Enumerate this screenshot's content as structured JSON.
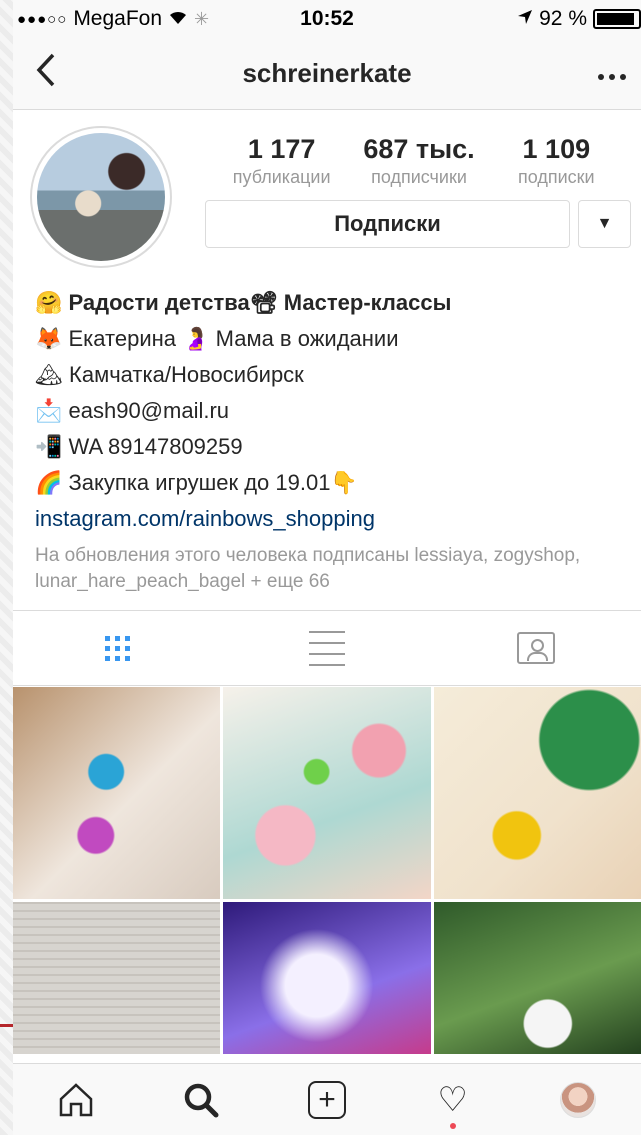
{
  "status_bar": {
    "signal": "●●●○○",
    "carrier": "MegaFon",
    "time": "10:52",
    "battery": "92 %"
  },
  "header": {
    "back_icon": "chevron-left-icon",
    "username": "schreinerkate",
    "more_icon": "ellipsis-icon"
  },
  "profile": {
    "stats": [
      {
        "value": "1 177",
        "label": "публикации"
      },
      {
        "value": "687 тыс.",
        "label": "подписчики"
      },
      {
        "value": "1 109",
        "label": "подписки"
      }
    ],
    "follow_button": "Подписки",
    "dropdown_icon": "▼"
  },
  "bio": {
    "line1": "🤗 Радости детства📽 Мастер-классы",
    "line2": "🦊 Екатерина 🤰 Мама в ожидании",
    "line3": "🏔 Камчатка/Новосибирск",
    "line4": "📩 eash90@mail.ru",
    "line5": "📲 WA 89147809259",
    "line6": "🌈 Закупка игрушек до 19.01👇",
    "link": "instagram.com/rainbows_shopping",
    "followed_by": "На обновления этого человека подписаны lessiaya, zogyshop, lunar_hare_peach_bagel + еще 66"
  },
  "view_tabs": [
    {
      "name": "grid",
      "icon": "grid-icon",
      "active": true,
      "color": "#3897f0"
    },
    {
      "name": "list",
      "icon": "list-icon",
      "active": false
    },
    {
      "name": "tagged",
      "icon": "tagged-icon",
      "active": false
    }
  ],
  "tab_bar": {
    "items": [
      "home-icon",
      "search-icon",
      "add-icon",
      "heart-icon",
      "profile-icon"
    ],
    "heart_symbol": "♡",
    "plus_symbol": "+"
  }
}
